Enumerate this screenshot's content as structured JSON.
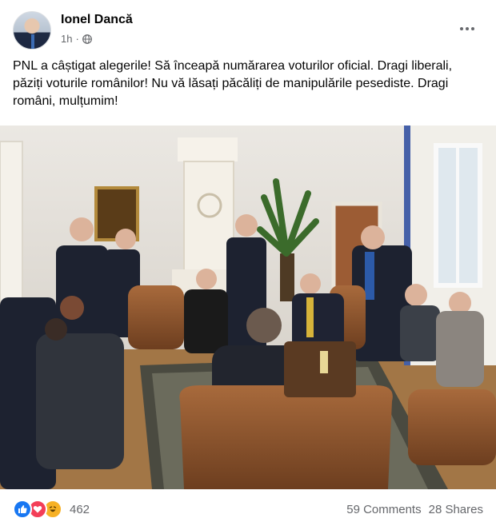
{
  "post": {
    "author": "Ionel Dancă",
    "time": "1h",
    "privacy_icon": "globe-icon",
    "text": "PNL a câștigat alegerile! Să înceapă numărarea voturilor oficial. Dragi liberali, păziți voturile românilor! Nu vă lăsați păcăliți de manipulările pesediste. Dragi români, mulțumim!"
  },
  "stats": {
    "reaction_icons": [
      "like-icon",
      "love-icon",
      "haha-icon"
    ],
    "reaction_count": "462",
    "comments": "59 Comments",
    "shares": "28 Shares"
  },
  "colors": {
    "like": "#1877f2",
    "love": "#f33e58",
    "haha": "#f7b125",
    "secondary_text": "#65676b"
  }
}
